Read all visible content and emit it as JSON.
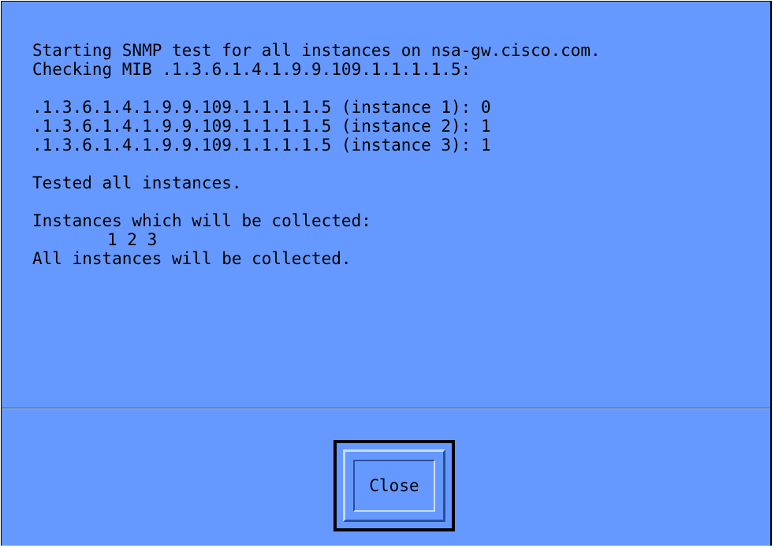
{
  "dialog": {
    "output_lines": [
      "Starting SNMP test for all instances on nsa-gw.cisco.com.",
      "Checking MIB .1.3.6.1.4.1.9.9.109.1.1.1.1.5:",
      ".1.3.6.1.4.1.9.9.109.1.1.1.1.5 (instance 1): 0",
      ".1.3.6.1.4.1.9.9.109.1.1.1.1.5 (instance 2): 1",
      ".1.3.6.1.4.1.9.9.109.1.1.1.1.5 (instance 3): 1",
      "Tested all instances.",
      "Instances which will be collected:",
      "1 2 3",
      "All instances will be collected."
    ],
    "close_label": "Close"
  },
  "colors": {
    "background": "#6699ff",
    "text": "#000000"
  }
}
